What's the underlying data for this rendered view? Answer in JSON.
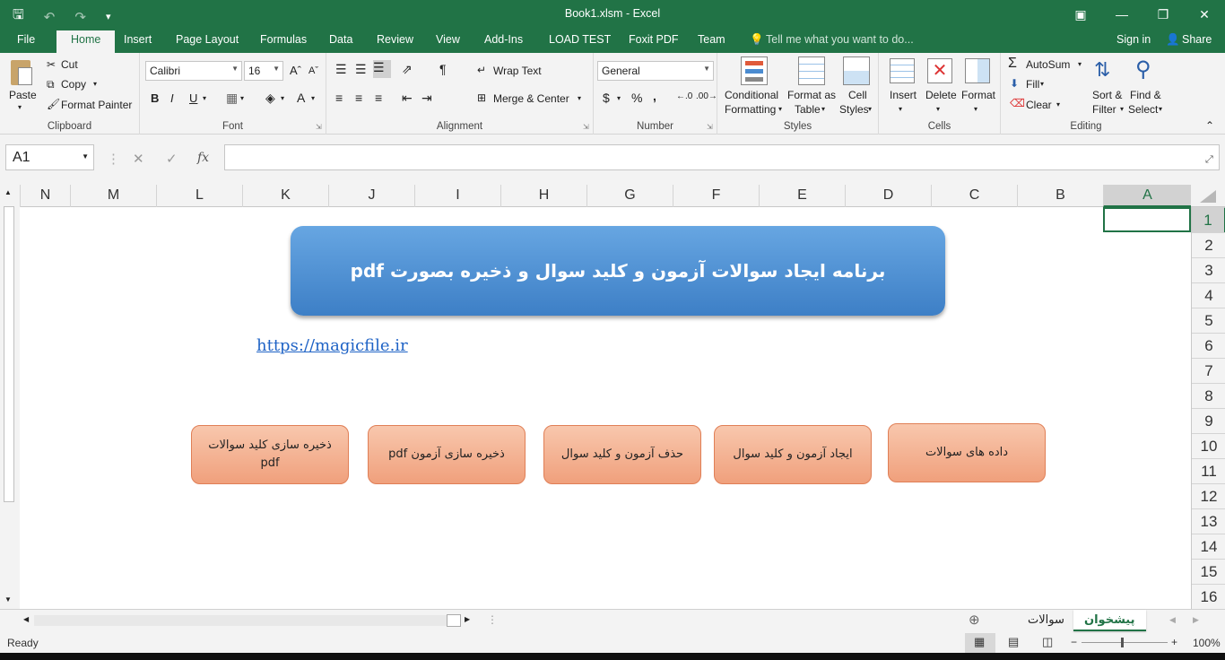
{
  "window": {
    "title": "Book1.xlsm - Excel"
  },
  "tabs": [
    "File",
    "Home",
    "Insert",
    "Page Layout",
    "Formulas",
    "Data",
    "Review",
    "View",
    "Add-Ins",
    "LOAD TEST",
    "Foxit PDF",
    "Team"
  ],
  "tell_me": "Tell me what you want to do...",
  "signin": "Sign in",
  "share": "Share",
  "ribbon": {
    "clipboard": {
      "label": "Clipboard",
      "paste": "Paste",
      "cut": "Cut",
      "copy": "Copy",
      "format_painter": "Format Painter"
    },
    "font": {
      "label": "Font",
      "name": "Calibri",
      "size": "16",
      "bold": "B",
      "italic": "I",
      "underline": "U"
    },
    "alignment": {
      "label": "Alignment",
      "wrap": "Wrap Text",
      "merge": "Merge & Center"
    },
    "number": {
      "label": "Number",
      "format": "General",
      "currency": "$",
      "percent": "%",
      "comma": ","
    },
    "styles": {
      "label": "Styles",
      "conditional": "Conditional",
      "conditional2": "Formatting",
      "format_as": "Format as",
      "format_as2": "Table",
      "cell": "Cell",
      "cell2": "Styles"
    },
    "cells": {
      "label": "Cells",
      "insert": "Insert",
      "delete": "Delete",
      "format": "Format"
    },
    "editing": {
      "label": "Editing",
      "autosum": "AutoSum",
      "fill": "Fill",
      "clear": "Clear",
      "sort": "Sort &",
      "sort2": "Filter",
      "find": "Find &",
      "find2": "Select"
    }
  },
  "formula": {
    "namebox": "A1",
    "fx": "fx",
    "value": ""
  },
  "columns": [
    "N",
    "M",
    "L",
    "K",
    "J",
    "I",
    "H",
    "G",
    "F",
    "E",
    "D",
    "C",
    "B",
    "A"
  ],
  "rows": [
    "1",
    "2",
    "3",
    "4",
    "5",
    "6",
    "7",
    "8",
    "9",
    "10",
    "11",
    "12",
    "13",
    "14",
    "15",
    "16"
  ],
  "sheet": {
    "banner": "برنامه ایجاد سوالات آزمون و کلید سوال و ذخیره بصورت pdf",
    "link": "https://magicfile.ir",
    "buttons": [
      "ذخیره سازی کلید سوالات pdf",
      "ذخیره سازی آزمون pdf",
      "حذف آزمون و کلید سوال",
      "ایجاد آزمون و کلید سوال",
      "داده های سوالات"
    ]
  },
  "sheet_tabs": [
    "سوالات",
    "پیشخوان"
  ],
  "status": {
    "ready": "Ready",
    "zoom": "100%"
  },
  "colors": {
    "excel_green": "#217346",
    "banner_blue": "#4a8bd0",
    "button_orange": "#f4b08e"
  }
}
